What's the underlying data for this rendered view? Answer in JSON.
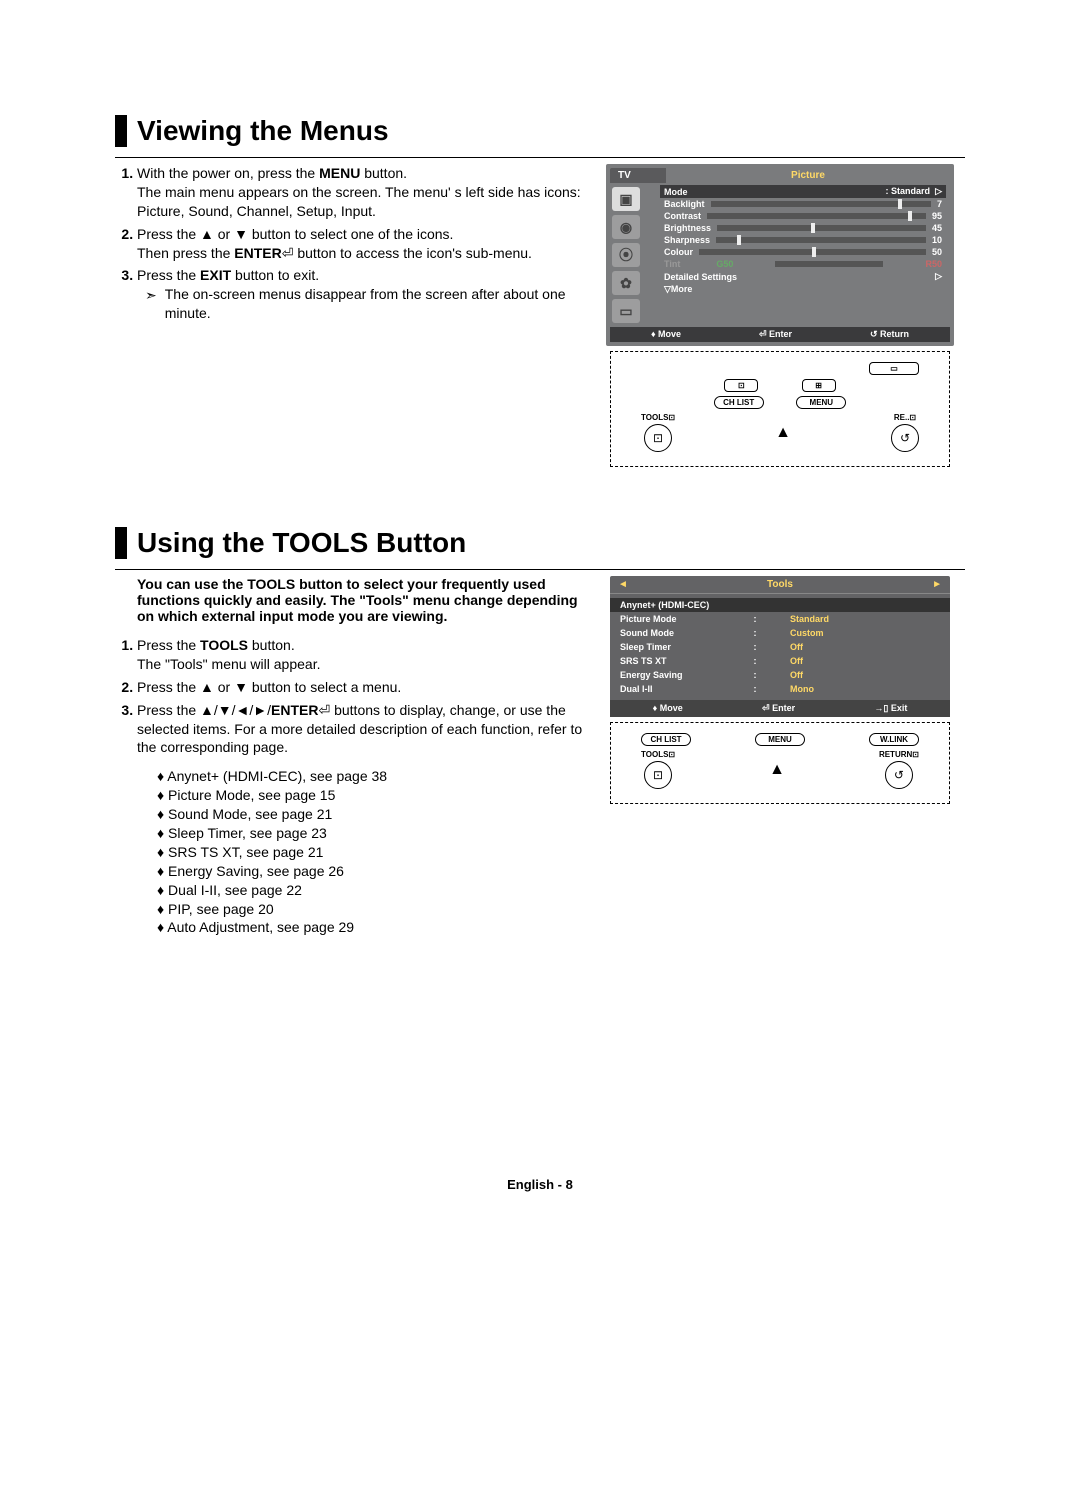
{
  "section1": {
    "title": "Viewing the Menus",
    "steps": {
      "s1a": "With the power on, press the ",
      "s1b": "MENU",
      "s1c": " button.",
      "s1d": "The main menu appears on the screen. The menu' s left side has icons: Picture, Sound, Channel, Setup, Input.",
      "s2a": "Press the ▲ or ▼ button to select one of the icons.",
      "s2b": "Then press the ",
      "s2c": "ENTER",
      "s2d": " button to access the icon's sub-menu.",
      "s3a": "Press the ",
      "s3b": "EXIT",
      "s3c": " button to exit.",
      "s3note": "The on-screen menus disappear from the screen after about one minute."
    }
  },
  "osd1": {
    "tv": "TV",
    "title": "Picture",
    "rows": {
      "mode": {
        "label": "Mode",
        "value": ": Standard"
      },
      "backlight": {
        "label": "Backlight",
        "value": "7"
      },
      "contrast": {
        "label": "Contrast",
        "value": "95"
      },
      "brightness": {
        "label": "Brightness",
        "value": "45"
      },
      "sharpness": {
        "label": "Sharpness",
        "value": "10"
      },
      "colour": {
        "label": "Colour",
        "value": "50"
      },
      "tint": {
        "label": "Tint",
        "g": "G50",
        "r": "R50"
      },
      "detailed": {
        "label": "Detailed Settings"
      },
      "more": {
        "label": "▽More"
      }
    },
    "footer": {
      "move": "Move",
      "enter": "Enter",
      "return": "Return"
    }
  },
  "remote": {
    "chlist": "CH LIST",
    "menu": "MENU",
    "wlink": "W.LINK",
    "tools": "TOOLS",
    "return": "RETURN"
  },
  "section2": {
    "title": "Using the TOOLS Button",
    "intro": "You can use the TOOLS button to select your frequently used functions quickly and easily. The \"Tools\" menu change depending on which external input mode you are viewing.",
    "steps": {
      "s1a": "Press the ",
      "s1b": "TOOLS",
      "s1c": " button.",
      "s1d": "The \"Tools\" menu will appear.",
      "s2": "Press the ▲ or ▼ button to select a menu.",
      "s3a": "Press the ▲/▼/◄/►/",
      "s3b": "ENTER",
      "s3c": " buttons to display, change, or use the selected items. For a more detailed description of each function, refer to the corresponding page."
    },
    "bullets": [
      "Anynet+ (HDMI-CEC), see page 38",
      "Picture Mode, see page 15",
      "Sound Mode, see page 21",
      "Sleep Timer, see page 23",
      "SRS TS XT, see page 21",
      "Energy Saving, see page 26",
      "Dual I-II, see page 22",
      "PIP, see page 20",
      "Auto Adjustment, see page 29"
    ]
  },
  "tools": {
    "title": "Tools",
    "rows": [
      {
        "label": "Anynet+ (HDMI-CEC)",
        "value": "",
        "selected": true
      },
      {
        "label": "Picture Mode",
        "value": "Standard"
      },
      {
        "label": "Sound Mode",
        "value": "Custom"
      },
      {
        "label": "Sleep Timer",
        "value": "Off"
      },
      {
        "label": "SRS TS XT",
        "value": "Off"
      },
      {
        "label": "Energy Saving",
        "value": "Off"
      },
      {
        "label": "Dual I-II",
        "value": "Mono"
      }
    ],
    "footer": {
      "move": "Move",
      "enter": "Enter",
      "exit": "Exit"
    }
  },
  "footer": "English - 8"
}
